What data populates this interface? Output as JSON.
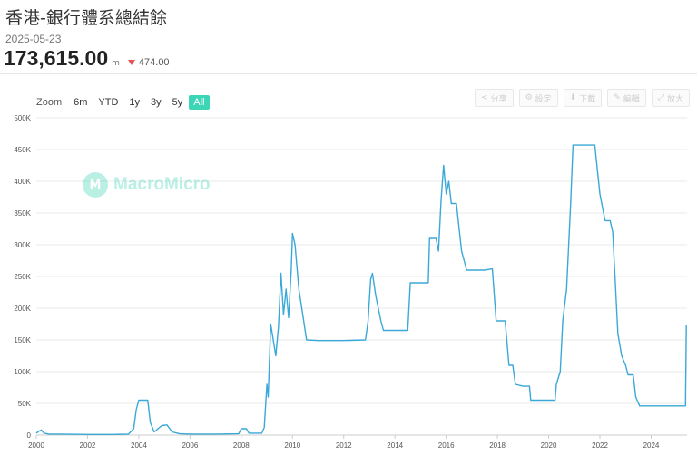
{
  "header": {
    "title": "香港-銀行體系總結餘",
    "date": "2025-05-23",
    "value": "173,615.00",
    "unit": "m",
    "change": "474.00"
  },
  "zoom": {
    "label": "Zoom",
    "buttons": [
      "6m",
      "YTD",
      "1y",
      "3y",
      "5y",
      "All"
    ],
    "active": "All"
  },
  "tools": [
    {
      "icon": "share-icon",
      "glyph": "<",
      "label": "分享"
    },
    {
      "icon": "gear-icon",
      "glyph": "⚙",
      "label": "設定"
    },
    {
      "icon": "download-icon",
      "glyph": "⬇",
      "label": "下載"
    },
    {
      "icon": "edit-icon",
      "glyph": "✎",
      "label": "編輯"
    },
    {
      "icon": "expand-icon",
      "glyph": "⤢",
      "label": "放大"
    }
  ],
  "watermark": "MacroMicro",
  "colors": {
    "line": "#3aa8d8",
    "accent": "#3cd5b5",
    "down": "#e55353"
  },
  "chart_data": {
    "type": "line",
    "xlabel": "",
    "ylabel": "",
    "ylim": [
      0,
      500000
    ],
    "xlim": [
      2000.0,
      2025.4
    ],
    "yticks": [
      0,
      50000,
      100000,
      150000,
      200000,
      250000,
      300000,
      350000,
      400000,
      450000,
      500000
    ],
    "ytick_labels": [
      "0",
      "50K",
      "100K",
      "150K",
      "200K",
      "250K",
      "300K",
      "350K",
      "400K",
      "450K",
      "500K"
    ],
    "xticks": [
      "2000",
      "2002",
      "2004",
      "2006",
      "2008",
      "2010",
      "2012",
      "2014",
      "2016",
      "2018",
      "2020",
      "2022",
      "2024"
    ],
    "grid": true,
    "series": [
      {
        "values": [
          [
            2000.0,
            3000
          ],
          [
            2000.1,
            6000
          ],
          [
            2000.2,
            8000
          ],
          [
            2000.3,
            3000
          ],
          [
            2000.5,
            1500
          ],
          [
            2001.0,
            1500
          ],
          [
            2002.0,
            1000
          ],
          [
            2003.0,
            1000
          ],
          [
            2003.6,
            1500
          ],
          [
            2003.8,
            10000
          ],
          [
            2003.9,
            40000
          ],
          [
            2004.0,
            55000
          ],
          [
            2004.35,
            55000
          ],
          [
            2004.45,
            20000
          ],
          [
            2004.6,
            5000
          ],
          [
            2004.9,
            15000
          ],
          [
            2005.1,
            16000
          ],
          [
            2005.3,
            5000
          ],
          [
            2005.6,
            2000
          ],
          [
            2006.0,
            1500
          ],
          [
            2007.0,
            1500
          ],
          [
            2007.9,
            2000
          ],
          [
            2008.0,
            10000
          ],
          [
            2008.2,
            10000
          ],
          [
            2008.3,
            3000
          ],
          [
            2008.8,
            3000
          ],
          [
            2008.9,
            12000
          ],
          [
            2009.0,
            80000
          ],
          [
            2009.05,
            60000
          ],
          [
            2009.15,
            175000
          ],
          [
            2009.25,
            150000
          ],
          [
            2009.35,
            125000
          ],
          [
            2009.45,
            170000
          ],
          [
            2009.55,
            255000
          ],
          [
            2009.65,
            190000
          ],
          [
            2009.75,
            230000
          ],
          [
            2009.85,
            185000
          ],
          [
            2009.95,
            260000
          ],
          [
            2010.0,
            318000
          ],
          [
            2010.1,
            300000
          ],
          [
            2010.25,
            230000
          ],
          [
            2010.4,
            190000
          ],
          [
            2010.55,
            150000
          ],
          [
            2011.0,
            149000
          ],
          [
            2012.0,
            149000
          ],
          [
            2012.85,
            150000
          ],
          [
            2012.95,
            180000
          ],
          [
            2013.05,
            245000
          ],
          [
            2013.12,
            255000
          ],
          [
            2013.25,
            220000
          ],
          [
            2013.45,
            180000
          ],
          [
            2013.55,
            165000
          ],
          [
            2014.0,
            165000
          ],
          [
            2014.5,
            165000
          ],
          [
            2014.6,
            240000
          ],
          [
            2015.0,
            240000
          ],
          [
            2015.3,
            240000
          ],
          [
            2015.35,
            310000
          ],
          [
            2015.6,
            310000
          ],
          [
            2015.7,
            290000
          ],
          [
            2015.8,
            370000
          ],
          [
            2015.9,
            425000
          ],
          [
            2016.0,
            380000
          ],
          [
            2016.1,
            400000
          ],
          [
            2016.2,
            365000
          ],
          [
            2016.4,
            365000
          ],
          [
            2016.6,
            290000
          ],
          [
            2016.8,
            260000
          ],
          [
            2017.0,
            260000
          ],
          [
            2017.5,
            260000
          ],
          [
            2017.8,
            262000
          ],
          [
            2017.95,
            180000
          ],
          [
            2018.3,
            180000
          ],
          [
            2018.45,
            110000
          ],
          [
            2018.6,
            110000
          ],
          [
            2018.7,
            80000
          ],
          [
            2019.0,
            77000
          ],
          [
            2019.25,
            77000
          ],
          [
            2019.3,
            55000
          ],
          [
            2019.8,
            55000
          ],
          [
            2020.0,
            55000
          ],
          [
            2020.25,
            55000
          ],
          [
            2020.3,
            80000
          ],
          [
            2020.45,
            100000
          ],
          [
            2020.55,
            180000
          ],
          [
            2020.7,
            230000
          ],
          [
            2020.85,
            360000
          ],
          [
            2020.95,
            457000
          ],
          [
            2021.2,
            457000
          ],
          [
            2021.8,
            457000
          ],
          [
            2022.0,
            380000
          ],
          [
            2022.2,
            338000
          ],
          [
            2022.4,
            338000
          ],
          [
            2022.5,
            320000
          ],
          [
            2022.6,
            240000
          ],
          [
            2022.7,
            160000
          ],
          [
            2022.85,
            125000
          ],
          [
            2023.0,
            110000
          ],
          [
            2023.1,
            95000
          ],
          [
            2023.3,
            95000
          ],
          [
            2023.4,
            60000
          ],
          [
            2023.55,
            46000
          ],
          [
            2024.0,
            46000
          ],
          [
            2024.5,
            46000
          ],
          [
            2025.0,
            46000
          ],
          [
            2025.34,
            46000
          ],
          [
            2025.37,
            173615
          ]
        ]
      }
    ]
  }
}
